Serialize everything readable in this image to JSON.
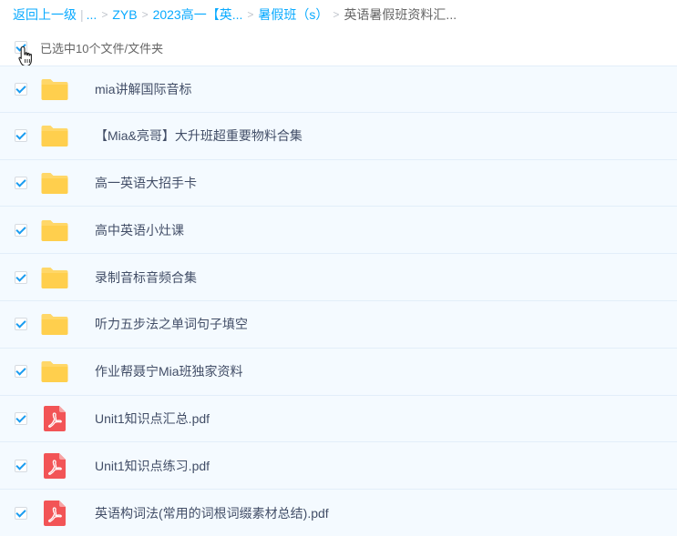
{
  "breadcrumb": {
    "back": "返回上一级",
    "ellipsis": "...",
    "items": [
      "ZYB",
      "2023高一【英...",
      "暑假班（s）"
    ],
    "current": "英语暑假班资料汇..."
  },
  "selection": {
    "text": "已选中10个文件/文件夹"
  },
  "colors": {
    "accent": "#09aaff",
    "folder": "#ffd768",
    "pdf": "#f25456",
    "row_bg": "#f4faff"
  },
  "files": [
    {
      "name": "mia讲解国际音标",
      "type": "folder",
      "checked": true
    },
    {
      "name": "【Mia&亮哥】大升班超重要物料合集",
      "type": "folder",
      "checked": true
    },
    {
      "name": "高一英语大招手卡",
      "type": "folder",
      "checked": true
    },
    {
      "name": "高中英语小灶课",
      "type": "folder",
      "checked": true
    },
    {
      "name": "录制音标音频合集",
      "type": "folder",
      "checked": true
    },
    {
      "name": "听力五步法之单词句子填空",
      "type": "folder",
      "checked": true
    },
    {
      "name": "作业帮聂宁Mia班独家资料",
      "type": "folder",
      "checked": true
    },
    {
      "name": "Unit1知识点汇总.pdf",
      "type": "pdf",
      "checked": true
    },
    {
      "name": "Unit1知识点练习.pdf",
      "type": "pdf",
      "checked": true
    },
    {
      "name": "英语构词法(常用的词根词缀素材总结).pdf",
      "type": "pdf",
      "checked": true
    }
  ]
}
